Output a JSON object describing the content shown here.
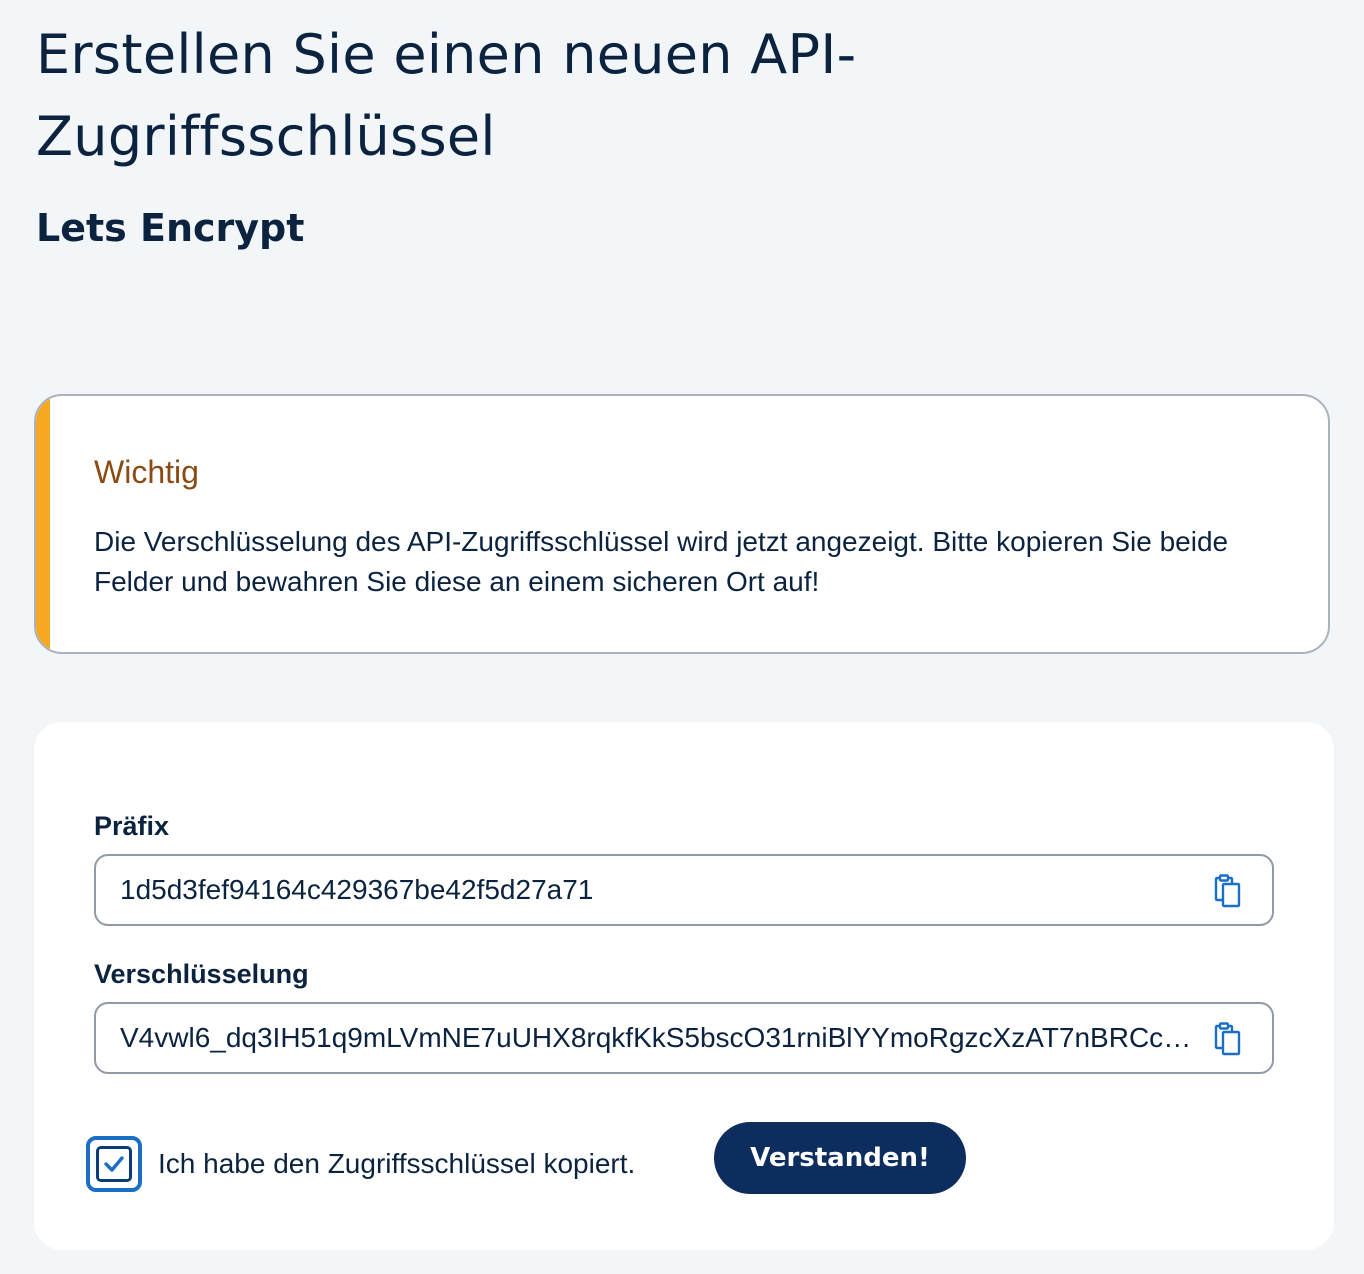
{
  "header": {
    "title": "Erstellen Sie einen neuen API-Zugriffsschlüssel",
    "subtitle": "Lets Encrypt"
  },
  "notice": {
    "title": "Wichtig",
    "text": "Die Verschlüsselung des API-Zugriffsschlüssel wird jetzt angezeigt. Bitte kopieren Sie beide Felder und bewahren Sie diese an einem sicheren Ort auf!",
    "accent_color": "#f7a823"
  },
  "form": {
    "prefix": {
      "label": "Präfix",
      "value": "1d5d3fef94164c429367be42f5d27a71",
      "copy_icon": "copy-icon"
    },
    "encryption": {
      "label": "Verschlüsselung",
      "value": "V4vwl6_dq3IH51q9mLVmNE7uUHX8rqkfKkS5bscO31rniBlYYmoRgzcXzAT7nBRCc4...",
      "copy_icon": "copy-icon"
    },
    "confirm": {
      "label": "Ich habe den Zugriffsschlüssel kopiert.",
      "checked": true
    },
    "submit_label": "Verstanden!"
  },
  "colors": {
    "background": "#f3f6f9",
    "text": "#0c2340",
    "button": "#0c2d5e",
    "icon": "#1a6fc4",
    "notice_title": "#8a4a12"
  }
}
